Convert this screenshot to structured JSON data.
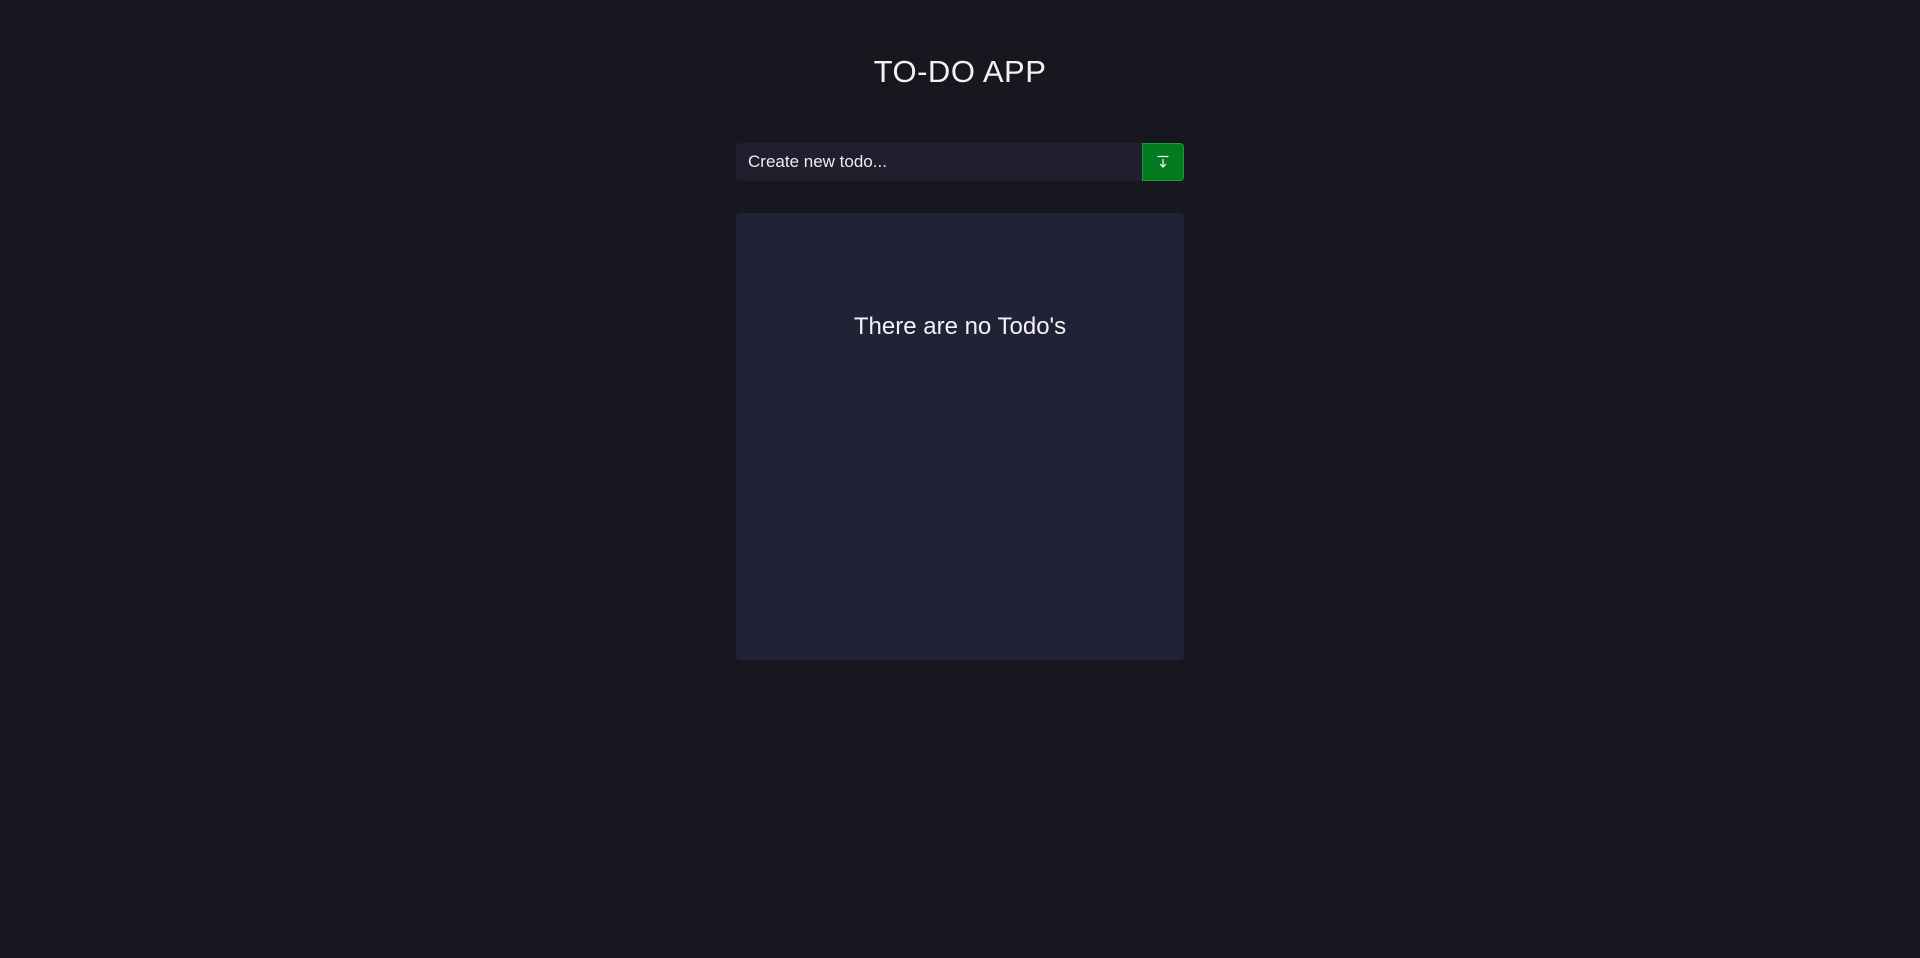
{
  "header": {
    "title": "TO-DO APP"
  },
  "form": {
    "input_placeholder": "Create new todo...",
    "input_value": "",
    "add_button_icon": "download-arrow-icon",
    "accent_color": "#047a1f"
  },
  "todo_list": {
    "items": [],
    "empty_message": "There are no Todo's"
  },
  "colors": {
    "background": "#17171f",
    "panel": "#212236",
    "input": "#1f1f2e",
    "text": "#f2f2f5"
  }
}
